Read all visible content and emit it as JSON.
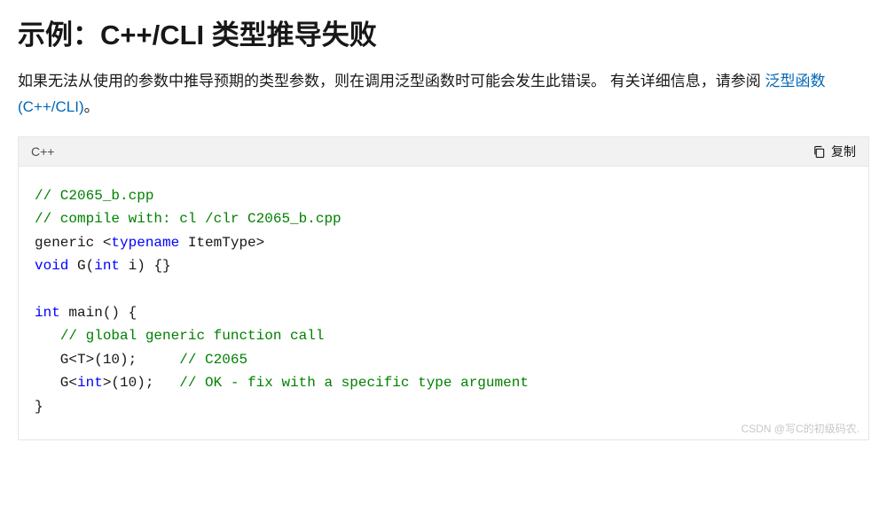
{
  "heading": "示例：C++/CLI 类型推导失败",
  "paragraph": {
    "text_before_link": "如果无法从使用的参数中推导预期的类型参数，则在调用泛型函数时可能会发生此错误。 有关详细信息，请参阅",
    "link_text": "泛型函数 (C++/CLI)",
    "text_after_link": "。"
  },
  "code_header": {
    "language": "C++",
    "copy_label": "复制"
  },
  "code_tokens": [
    {
      "class": "tok-comment",
      "text": "// C2065_b.cpp"
    },
    {
      "class": "",
      "text": "\n"
    },
    {
      "class": "tok-comment",
      "text": "// compile with: cl /clr C2065_b.cpp"
    },
    {
      "class": "",
      "text": "\n"
    },
    {
      "class": "tok-plain",
      "text": "generic <"
    },
    {
      "class": "tok-keyword",
      "text": "typename"
    },
    {
      "class": "tok-plain",
      "text": " ItemType>"
    },
    {
      "class": "",
      "text": "\n"
    },
    {
      "class": "tok-keyword",
      "text": "void"
    },
    {
      "class": "tok-plain",
      "text": " G("
    },
    {
      "class": "tok-keyword",
      "text": "int"
    },
    {
      "class": "tok-plain",
      "text": " i) {}"
    },
    {
      "class": "",
      "text": "\n"
    },
    {
      "class": "",
      "text": "\n"
    },
    {
      "class": "tok-keyword",
      "text": "int"
    },
    {
      "class": "tok-plain",
      "text": " main() {"
    },
    {
      "class": "",
      "text": "\n"
    },
    {
      "class": "tok-plain",
      "text": "   "
    },
    {
      "class": "tok-comment",
      "text": "// global generic function call"
    },
    {
      "class": "",
      "text": "\n"
    },
    {
      "class": "tok-plain",
      "text": "   G<T>("
    },
    {
      "class": "tok-plain",
      "text": "10"
    },
    {
      "class": "tok-plain",
      "text": ");     "
    },
    {
      "class": "tok-comment",
      "text": "// C2065"
    },
    {
      "class": "",
      "text": "\n"
    },
    {
      "class": "tok-plain",
      "text": "   G<"
    },
    {
      "class": "tok-keyword",
      "text": "int"
    },
    {
      "class": "tok-plain",
      "text": ">("
    },
    {
      "class": "tok-plain",
      "text": "10"
    },
    {
      "class": "tok-plain",
      "text": ");   "
    },
    {
      "class": "tok-comment",
      "text": "// OK - fix with a specific type argument"
    },
    {
      "class": "",
      "text": "\n"
    },
    {
      "class": "tok-plain",
      "text": "}"
    }
  ],
  "watermark": "CSDN @写C的初级码农."
}
